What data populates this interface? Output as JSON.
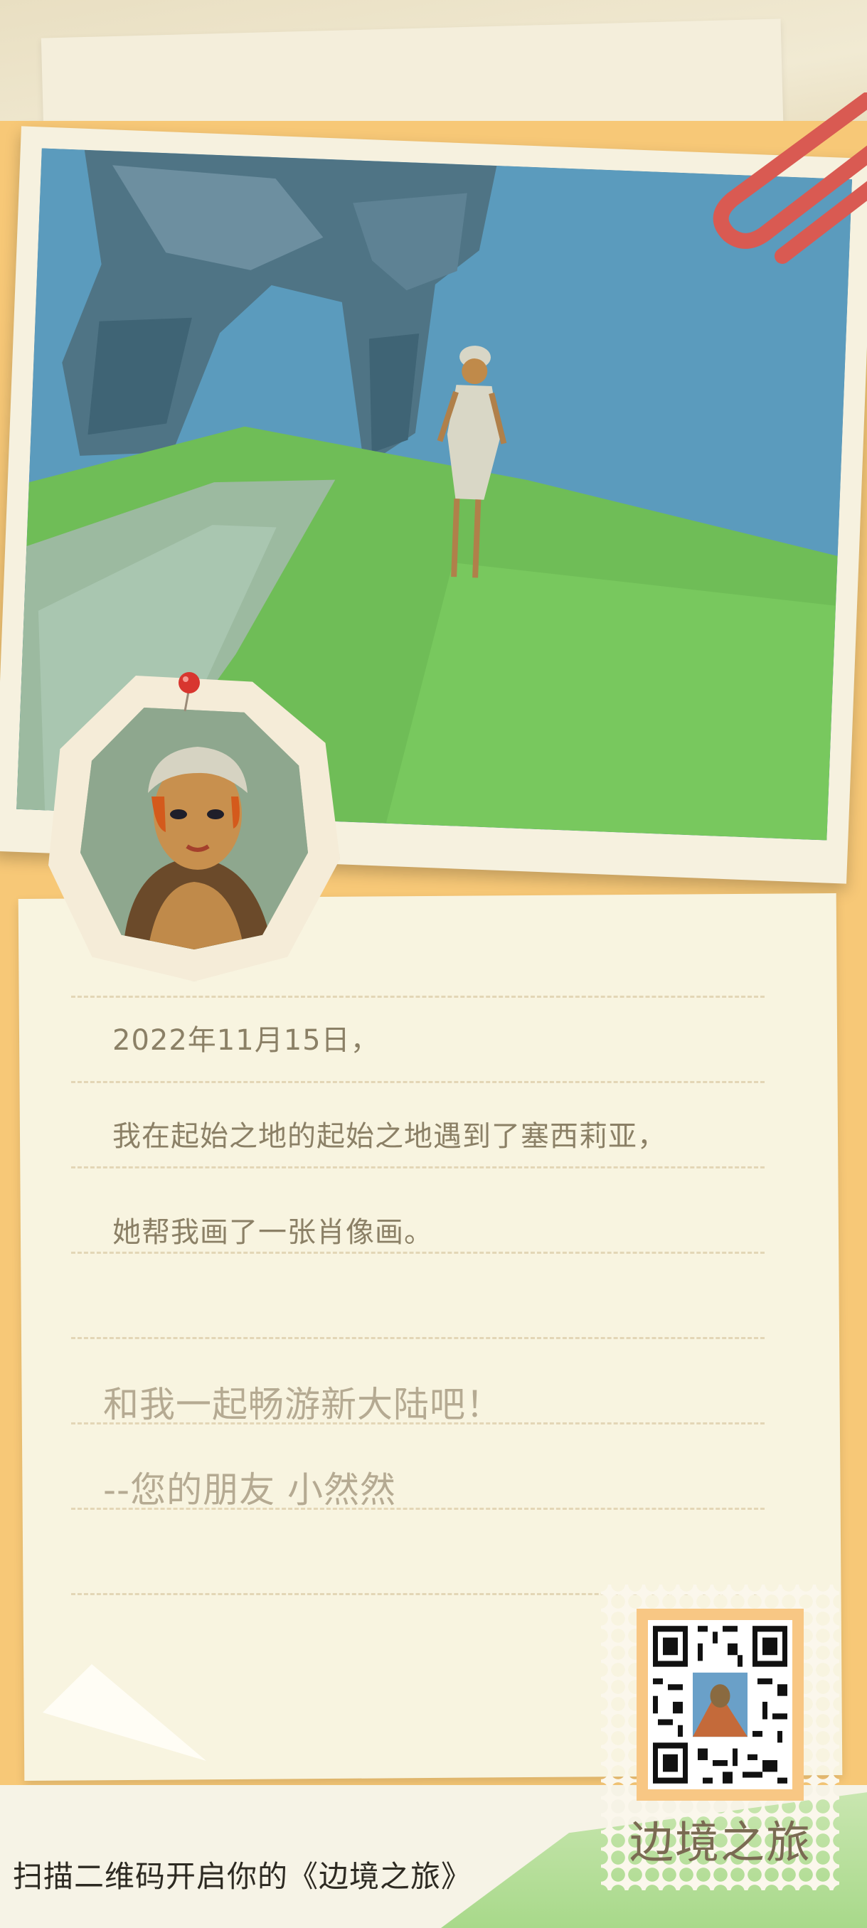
{
  "letter": {
    "lines": [
      "2022年11月15日，",
      "我在起始之地的起始之地遇到了塞西莉亚，",
      "她帮我画了一张肖像画。"
    ],
    "closing": [
      "和我一起畅游新大陆吧！",
      "--您的朋友  小然然"
    ]
  },
  "footer": {
    "cta": "扫描二维码开启你的《边境之旅》"
  },
  "stamp": {
    "title": "边境之旅"
  },
  "colors": {
    "envelope": "#f7c877",
    "paper": "#f8f4e0",
    "text": "#8b8066",
    "sky": "#4e89aa",
    "grass": "#6fbd57"
  }
}
